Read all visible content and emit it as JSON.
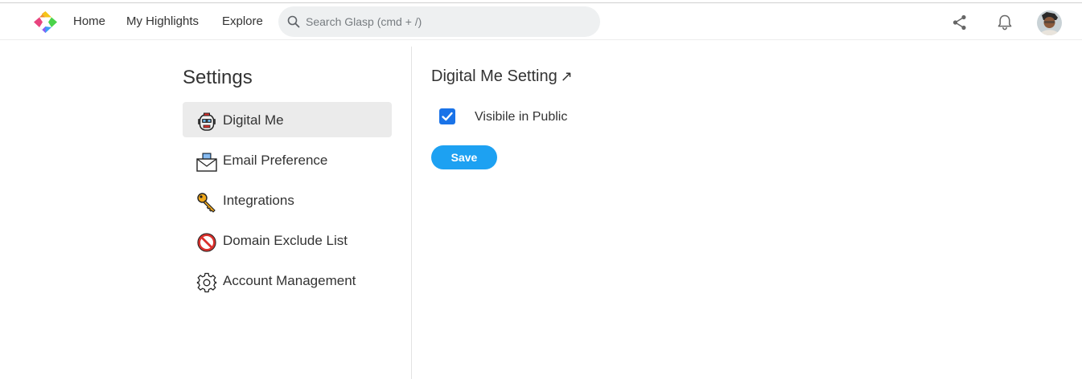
{
  "header": {
    "nav": [
      {
        "label": "Home"
      },
      {
        "label": "My Highlights"
      },
      {
        "label": "Explore"
      }
    ],
    "search": {
      "placeholder": "Search Glasp (cmd + /)",
      "value": ""
    },
    "icons": [
      "glasp-logo-icon",
      "share-icon",
      "bell-icon",
      "avatar"
    ]
  },
  "sidebar": {
    "title": "Settings",
    "items": [
      {
        "label": "Digital Me",
        "icon": "robot-icon",
        "active": true
      },
      {
        "label": "Email Preference",
        "icon": "envelope-icon",
        "active": false
      },
      {
        "label": "Integrations",
        "icon": "key-icon",
        "active": false
      },
      {
        "label": "Domain Exclude List",
        "icon": "prohibited-icon",
        "active": false
      },
      {
        "label": "Account Management",
        "icon": "gear-icon",
        "active": false
      }
    ]
  },
  "main": {
    "title": "Digital Me Setting",
    "title_arrow": "↗",
    "visibility": {
      "label": "Visibile in Public",
      "checked": true
    },
    "save_label": "Save"
  },
  "colors": {
    "accent": "#1da1f2",
    "checkbox": "#1a73e8",
    "active_item_bg": "#ebebeb",
    "search_bg": "#eef0f1"
  }
}
